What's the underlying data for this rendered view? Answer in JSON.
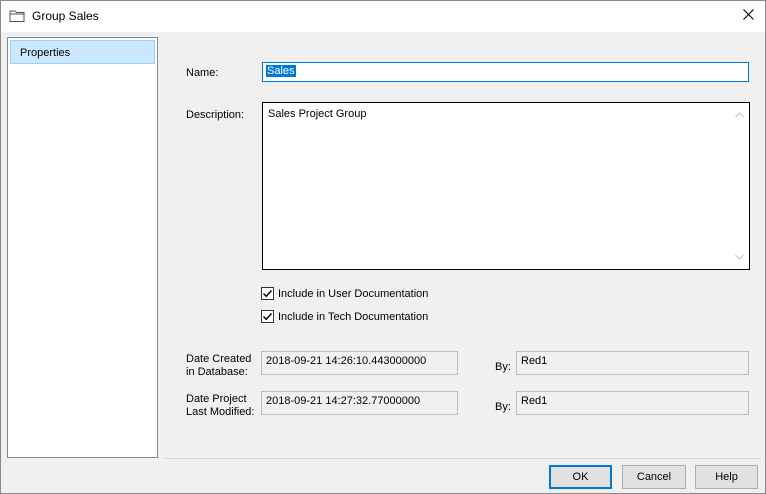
{
  "window": {
    "title": "Group Sales",
    "title_icon": "folder-icon",
    "close_icon": "close-icon"
  },
  "nav": {
    "items": [
      {
        "label": "Properties",
        "selected": true
      }
    ]
  },
  "form": {
    "name_label": "Name:",
    "name_value": "Sales",
    "description_label": "Description:",
    "description_value": "Sales Project Group",
    "include_user_doc_label": "Include in User Documentation",
    "include_user_doc_checked": true,
    "include_tech_doc_label": "Include in Tech Documentation",
    "include_tech_doc_checked": true,
    "date_created_label_line1": "Date Created",
    "date_created_label_line2": "in Database:",
    "date_created_value": "2018-09-21 14:26:10.443000000",
    "created_by_label": "By:",
    "created_by_value": "Red1",
    "last_modified_label_line1": "Date Project",
    "last_modified_label_line2": "Last Modified:",
    "last_modified_value": "2018-09-21 14:27:32.77000000",
    "modified_by_label": "By:",
    "modified_by_value": "Red1"
  },
  "buttons": {
    "ok": "OK",
    "cancel": "Cancel",
    "help": "Help"
  },
  "colors": {
    "accent": "#0078d7",
    "selection_bg": "#cce8ff",
    "window_bg": "#f0f0f0"
  }
}
